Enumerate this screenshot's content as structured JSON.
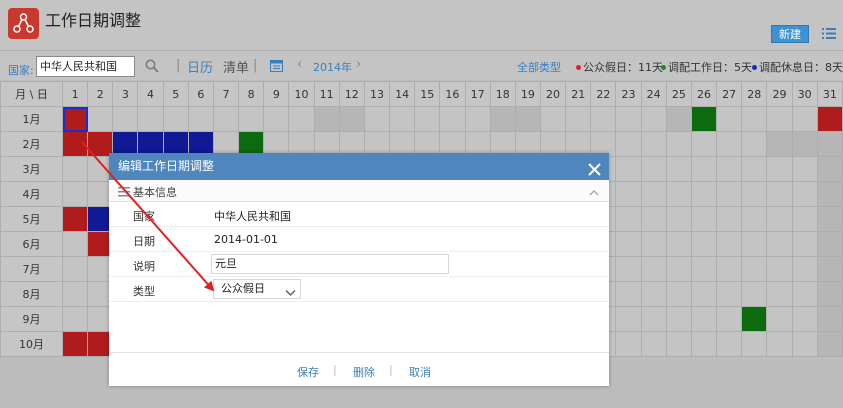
{
  "header": {
    "title": "工作日期调整",
    "logo_icon": "share-nodes-icon",
    "new_button": "新建",
    "menu_icon": "list-icon"
  },
  "toolbar": {
    "country_label": "国家:",
    "country_value": "中华人民共和国",
    "search_icon": "search-icon",
    "view_calendar": "日历",
    "view_list": "清单",
    "calendar_icon": "calendar-icon",
    "prev": "‹",
    "year": "2014年",
    "next": "›",
    "filter_all": "全部类型",
    "legend": [
      {
        "label": "公众假日：11天",
        "color": "#e02020"
      },
      {
        "label": "调配工作日：5天",
        "color": "#1a8a1a"
      },
      {
        "label": "调配休息日：8天",
        "color": "#1a2ab0"
      }
    ]
  },
  "colors": {
    "holiday": "#b01c1c",
    "workday": "#0e6a0e",
    "restday": "#101a95",
    "accent": "#4f86be"
  },
  "grid": {
    "corner": "月 \\ 日",
    "days": [
      "1",
      "2",
      "3",
      "4",
      "5",
      "6",
      "7",
      "8",
      "9",
      "10",
      "11",
      "12",
      "13",
      "14",
      "15",
      "16",
      "17",
      "18",
      "19",
      "20",
      "21",
      "22",
      "23",
      "24",
      "25",
      "26",
      "27",
      "28",
      "29",
      "30",
      "31"
    ],
    "months": [
      "1月",
      "2月",
      "3月",
      "4月",
      "5月",
      "6月",
      "7月",
      "8月",
      "9月",
      "10月"
    ]
  },
  "dialog": {
    "title": "编辑工作日期调整",
    "close_icon": "close-icon",
    "section_icon": "list-icon",
    "section_title": "基本信息",
    "collapse_icon": "chevron-up-icon",
    "fields": {
      "country_label": "国家",
      "country_value": "中华人民共和国",
      "date_label": "日期",
      "date_value": "2014-01-01",
      "desc_label": "说明",
      "desc_value": "元旦",
      "type_label": "类型",
      "type_value": "公众假日"
    },
    "buttons": {
      "save": "保存",
      "delete": "删除",
      "cancel": "取消",
      "sep": "|"
    }
  }
}
